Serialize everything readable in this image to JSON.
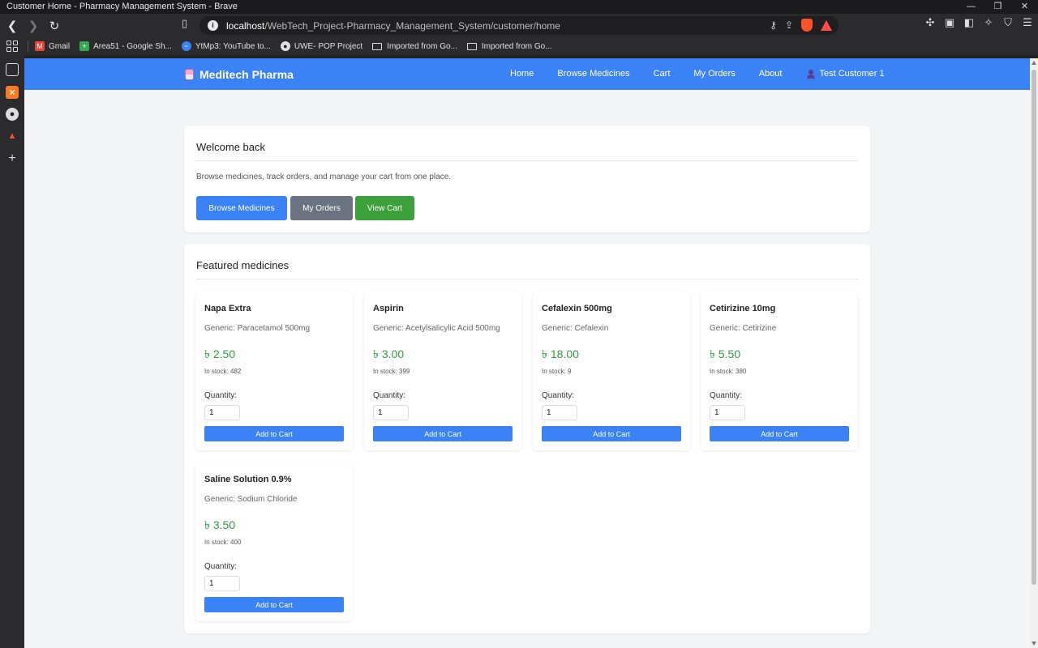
{
  "window": {
    "title": "Customer Home - Pharmacy Management System - Brave",
    "controls": {
      "minimize": "—",
      "restore": "❐",
      "close": "✕"
    }
  },
  "browser": {
    "url_host": "localhost",
    "url_path": "/WebTech_Project-Pharmacy_Management_System/customer/home",
    "bookmarks": [
      {
        "label": "Gmail",
        "icon": "gmail-icon",
        "color": "#ea4335"
      },
      {
        "label": "Area51 - Google Sh...",
        "icon": "sheets-icon",
        "color": "#34a853"
      },
      {
        "label": "YtMp3: YouTube to...",
        "icon": "ytmp3-icon",
        "color": "#3b82f6"
      },
      {
        "label": "UWE- POP Project",
        "icon": "github-icon",
        "color": "#e0e0e0"
      },
      {
        "label": "Imported from Go...",
        "icon": "folder-icon",
        "color": "#e0e0e0"
      },
      {
        "label": "Imported from Go...",
        "icon": "folder-icon",
        "color": "#e0e0e0"
      }
    ]
  },
  "site": {
    "brand": "Meditech Pharma",
    "nav": [
      "Home",
      "Browse Medicines",
      "Cart",
      "My Orders",
      "About"
    ],
    "user": "Test Customer 1",
    "accent": "#3b82f6"
  },
  "welcome": {
    "title": "Welcome back",
    "text": "Browse medicines, track orders, and manage your cart from one place.",
    "buttons": [
      {
        "label": "Browse Medicines",
        "color": "#3b82f6"
      },
      {
        "label": "My Orders",
        "color": "#6b7280"
      },
      {
        "label": "View Cart",
        "color": "#3ca13b"
      }
    ]
  },
  "featured": {
    "title": "Featured medicines",
    "quantity_label": "Quantity:",
    "add_label": "Add to Cart",
    "items": [
      {
        "name": "Napa Extra",
        "generic": "Generic: Paracetamol 500mg",
        "price": "৳ 2.50",
        "stock": "In stock: 482",
        "qty": "1"
      },
      {
        "name": "Aspirin",
        "generic": "Generic: Acetylsalicylic Acid 500mg",
        "price": "৳ 3.00",
        "stock": "In stock: 399",
        "qty": "1"
      },
      {
        "name": "Cefalexin 500mg",
        "generic": "Generic: Cefalexin",
        "price": "৳ 18.00",
        "stock": "In stock: 9",
        "qty": "1"
      },
      {
        "name": "Cetirizine 10mg",
        "generic": "Generic: Cetirizine",
        "price": "৳ 5.50",
        "stock": "In stock: 380",
        "qty": "1"
      },
      {
        "name": "Saline Solution 0.9%",
        "generic": "Generic: Sodium Chloride",
        "price": "৳ 3.50",
        "stock": "In stock: 400",
        "qty": "1"
      }
    ]
  }
}
